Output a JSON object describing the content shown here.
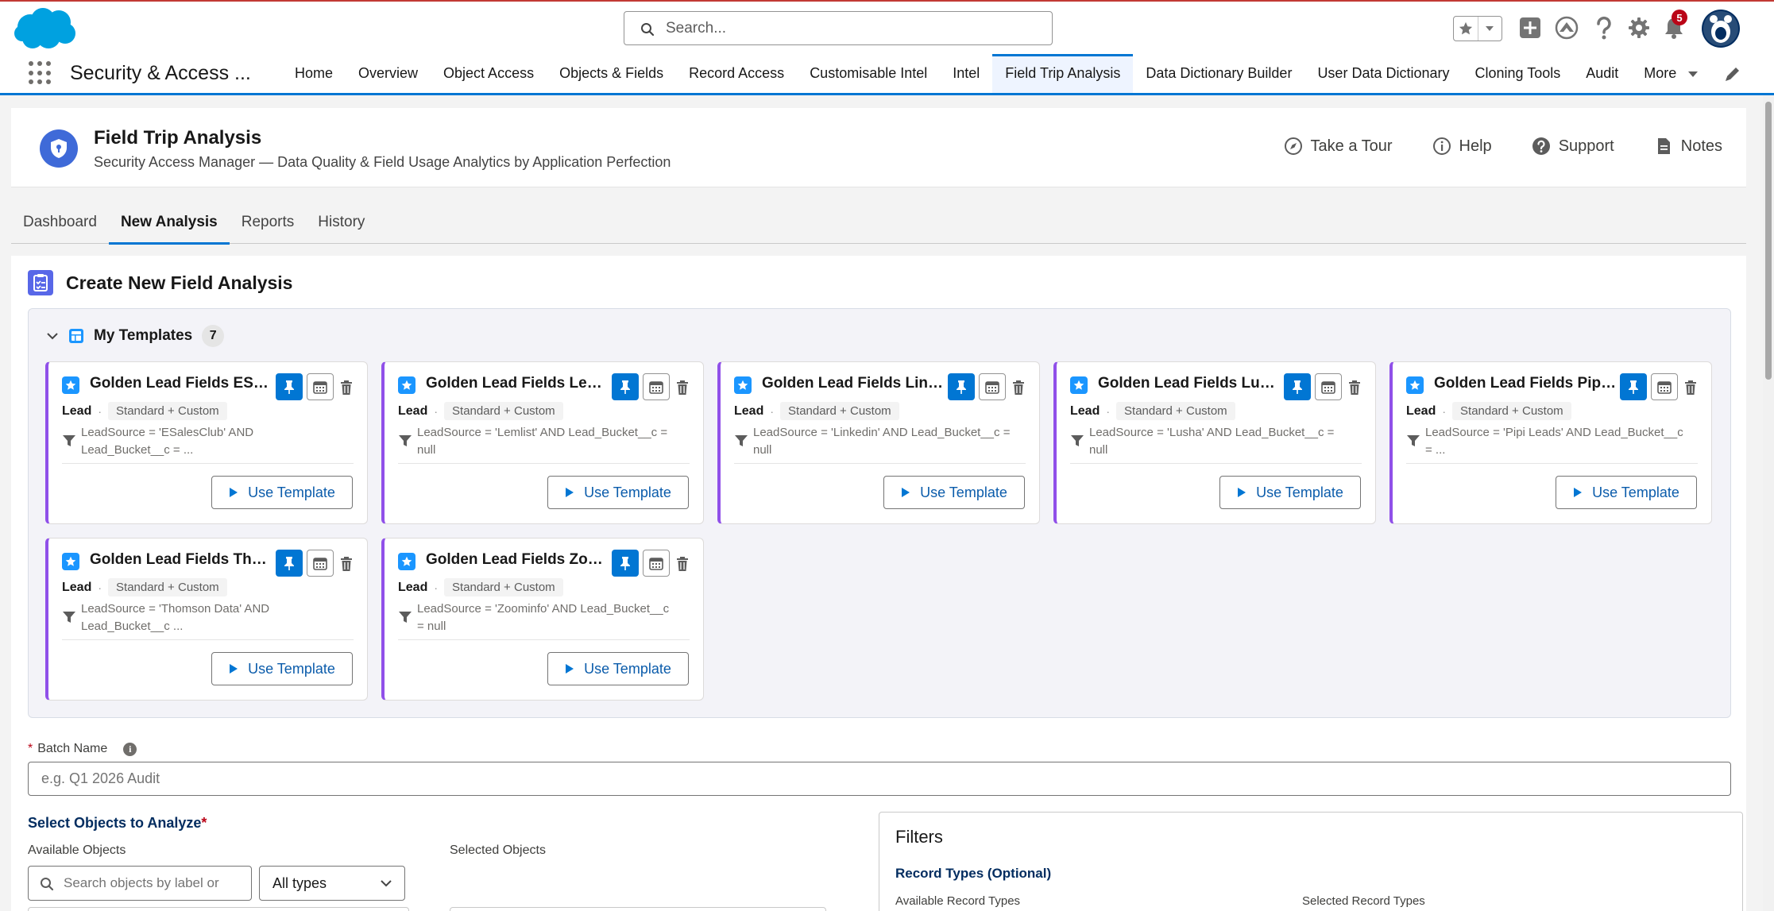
{
  "global": {
    "search_placeholder": "Search...",
    "notification_count": "5"
  },
  "nav": {
    "app_name": "Security & Access ...",
    "items": [
      "Home",
      "Overview",
      "Object Access",
      "Objects & Fields",
      "Record Access",
      "Customisable Intel",
      "Intel",
      "Field Trip Analysis",
      "Data Dictionary Builder",
      "User Data Dictionary",
      "Cloning Tools",
      "Audit"
    ],
    "more_label": "More",
    "active_item": "Field Trip Analysis"
  },
  "page_header": {
    "title": "Field Trip Analysis",
    "subtitle": "Security Access Manager — Data Quality & Field Usage Analytics by Application Perfection",
    "actions": [
      "Take a Tour",
      "Help",
      "Support",
      "Notes"
    ]
  },
  "tabs": [
    "Dashboard",
    "New Analysis",
    "Reports",
    "History"
  ],
  "active_tab": "New Analysis",
  "section": {
    "title": "Create New Field Analysis"
  },
  "templates": {
    "title": "My Templates",
    "count": "7",
    "use_label": "Use Template",
    "items": [
      {
        "name": "Golden Lead Fields ESalesClub",
        "object": "Lead",
        "scope": "Standard + Custom",
        "filter": "LeadSource = 'ESalesClub' AND Lead_Bucket__c = ..."
      },
      {
        "name": "Golden Lead Fields Lemlist",
        "object": "Lead",
        "scope": "Standard + Custom",
        "filter": "LeadSource = 'Lemlist' AND Lead_Bucket__c = null"
      },
      {
        "name": "Golden Lead Fields Linkedin",
        "object": "Lead",
        "scope": "Standard + Custom",
        "filter": "LeadSource = 'Linkedin' AND Lead_Bucket__c = null"
      },
      {
        "name": "Golden Lead Fields Lusha",
        "object": "Lead",
        "scope": "Standard + Custom",
        "filter": "LeadSource = 'Lusha' AND Lead_Bucket__c = null"
      },
      {
        "name": "Golden Lead Fields Pipi Leads",
        "object": "Lead",
        "scope": "Standard + Custom",
        "filter": "LeadSource = 'Pipi Leads' AND Lead_Bucket__c = ..."
      },
      {
        "name": "Golden Lead Fields Thomson Data",
        "object": "Lead",
        "scope": "Standard + Custom",
        "filter": "LeadSource = 'Thomson Data' AND Lead_Bucket__c ..."
      },
      {
        "name": "Golden Lead Fields Zoominfo",
        "object": "Lead",
        "scope": "Standard + Custom",
        "filter": "LeadSource = 'Zoominfo' AND Lead_Bucket__c = null"
      }
    ]
  },
  "form": {
    "batch_label": "Batch Name",
    "batch_placeholder": "e.g. Q1 2026 Audit",
    "objects_title": "Select Objects to Analyze",
    "available_label": "Available Objects",
    "selected_label": "Selected Objects",
    "object_search_placeholder": "Search objects by label or",
    "type_select": "All types"
  },
  "filters": {
    "title": "Filters",
    "record_types_title": "Record Types (Optional)",
    "available_label": "Available Record Types",
    "selected_label": "Selected Record Types"
  },
  "colors": {
    "brand": "#0176d3",
    "template_accent": "#9050e9"
  }
}
